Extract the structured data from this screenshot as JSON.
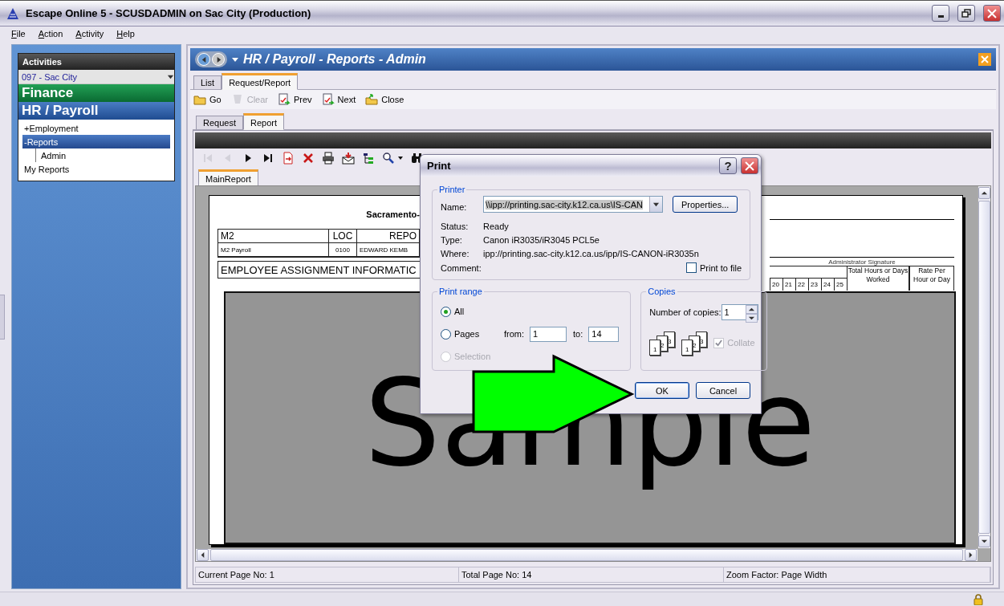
{
  "window": {
    "title": "Escape Online 5 - SCUSDADMIN on Sac City (Production)"
  },
  "menu": [
    "File",
    "Action",
    "Activity",
    "Help"
  ],
  "sidebar": {
    "header": "Activities",
    "district": "097 - Sac City",
    "modules": [
      {
        "label": "Finance",
        "kind": "finance"
      },
      {
        "label": "HR / Payroll",
        "kind": "hr"
      }
    ],
    "tree": [
      {
        "label": "+Employment",
        "selected": false
      },
      {
        "label": "-Reports",
        "selected": true,
        "children": [
          {
            "label": "Admin",
            "selected": false
          }
        ]
      },
      {
        "label": "My Reports",
        "selected": false
      }
    ]
  },
  "panel": {
    "title": "HR / Payroll - Reports - Admin",
    "tabs": [
      {
        "label": "List",
        "selected": false
      },
      {
        "label": "Request/Report",
        "selected": true
      }
    ],
    "toolbar": [
      {
        "label": "Go",
        "kind": "go",
        "disabled": false
      },
      {
        "label": "Clear",
        "kind": "clear",
        "disabled": true
      },
      {
        "label": "Prev",
        "kind": "prev",
        "disabled": false
      },
      {
        "label": "Next",
        "kind": "next",
        "disabled": false
      },
      {
        "label": "Close",
        "kind": "close",
        "disabled": false
      }
    ],
    "subtabs": [
      {
        "label": "Request",
        "selected": false
      },
      {
        "label": "Report",
        "selected": true
      }
    ],
    "viewer": {
      "tools": [
        {
          "kind": "first",
          "disabled": true
        },
        {
          "kind": "prev",
          "disabled": true
        },
        {
          "kind": "next",
          "disabled": false
        },
        {
          "kind": "last",
          "disabled": false
        },
        {
          "kind": "export",
          "disabled": false
        },
        {
          "kind": "delete",
          "disabled": false
        },
        {
          "kind": "print",
          "disabled": false
        },
        {
          "kind": "email",
          "disabled": false
        },
        {
          "kind": "tree",
          "disabled": false
        },
        {
          "kind": "zoom",
          "disabled": false
        },
        {
          "kind": "caret",
          "disabled": false
        },
        {
          "kind": "find",
          "disabled": false
        }
      ],
      "tabs": [
        {
          "label": "MainReport",
          "selected": true
        }
      ],
      "report": {
        "title": "Sacramento-",
        "header_columns": [
          "M2",
          "LOC",
          "REPO"
        ],
        "header_row": [
          "M2 Payroll",
          "0100",
          "EDWARD KEMB"
        ],
        "section": "EMPLOYEE ASSIGNMENT INFORMATIC",
        "signature_label": "Administrator Signature",
        "day_columns": [
          "20",
          "21",
          "22",
          "23",
          "24",
          "25"
        ],
        "total_columns": [
          "Total Hours or Days Worked",
          "Rate Per Hour or Day"
        ],
        "overlay": "Sample"
      },
      "status": [
        "Current Page No: 1",
        "Total Page No: 14",
        "Zoom Factor: Page Width"
      ]
    }
  },
  "dialog": {
    "title": "Print",
    "help_label": "?",
    "printer": {
      "legend": "Printer",
      "name_label": "Name:",
      "name": "\\\\ipp://printing.sac-city.k12.ca.us\\IS-CAN",
      "properties": "Properties...",
      "info": [
        {
          "label": "Status:",
          "value": "Ready"
        },
        {
          "label": "Type:",
          "value": "Canon iR3035/iR3045 PCL5e"
        },
        {
          "label": "Where:",
          "value": "ipp://printing.sac-city.k12.ca.us/ipp/IS-CANON-iR3035n"
        },
        {
          "label": "Comment:"
        }
      ],
      "print_to_file": {
        "label": "Print to file",
        "checked": false
      }
    },
    "range": {
      "legend": "Print range",
      "options": [
        {
          "label": "All",
          "selected": true,
          "disabled": false
        },
        {
          "label": "Pages",
          "selected": false,
          "disabled": false
        },
        {
          "label": "Selection",
          "selected": false,
          "disabled": true
        }
      ],
      "from_label": "from:",
      "from": "1",
      "to_label": "to:",
      "to": "14"
    },
    "copies": {
      "legend": "Copies",
      "label": "Number of copies:",
      "value": "1",
      "stacks": [
        [
          "1",
          "2",
          "3"
        ],
        [
          "1",
          "2",
          "3"
        ]
      ],
      "collate": {
        "label": "Collate",
        "checked": true,
        "disabled": true
      }
    },
    "buttons": [
      {
        "label": "OK",
        "default": true
      },
      {
        "label": "Cancel",
        "default": false
      }
    ]
  }
}
